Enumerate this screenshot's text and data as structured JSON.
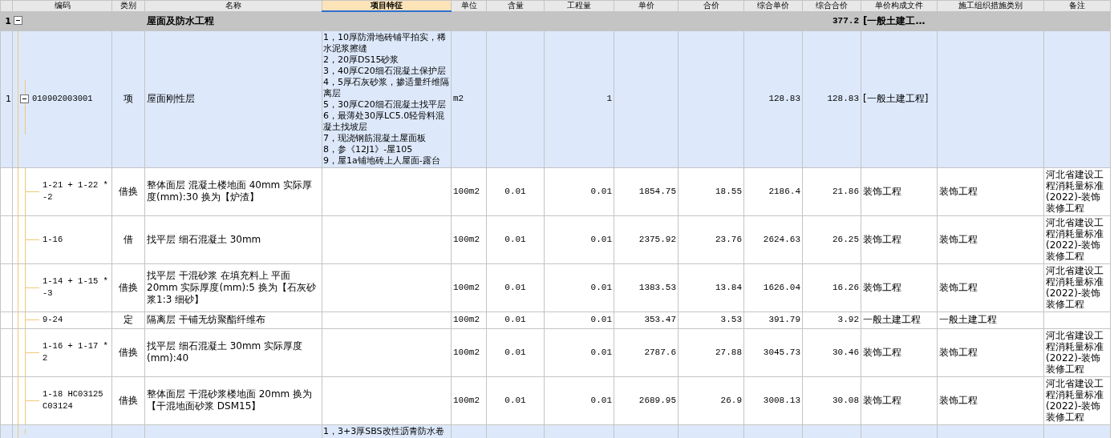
{
  "columns": [
    {
      "label": "编码",
      "selected": false
    },
    {
      "label": "类别",
      "selected": false
    },
    {
      "label": "名称",
      "selected": false
    },
    {
      "label": "项目特征",
      "selected": true
    },
    {
      "label": "单位",
      "selected": false
    },
    {
      "label": "含量",
      "selected": false
    },
    {
      "label": "工程量",
      "selected": false
    },
    {
      "label": "单价",
      "selected": false
    },
    {
      "label": "合价",
      "selected": false
    },
    {
      "label": "综合单价",
      "selected": false
    },
    {
      "label": "综合合价",
      "selected": false
    },
    {
      "label": "单价构成文件",
      "selected": false
    },
    {
      "label": "施工组织措施类别",
      "selected": false
    },
    {
      "label": "备注",
      "selected": false
    }
  ],
  "rows": [
    {
      "kind": "group",
      "number": "1",
      "expanded": true,
      "name": "屋面及防水工程",
      "comp_total": "377.2",
      "price_file": "[一般土建工…"
    },
    {
      "kind": "item",
      "number": "1",
      "expanded": true,
      "code": "010902003001",
      "type": "项",
      "name": "屋面刚性层",
      "features": "1，10厚防滑地砖铺平拍实，稀水泥浆擦缝\n2，20厚DS15砂浆\n3，40厚C20细石混凝土保护层\n4，5厚石灰砂浆，掺适量纤维隔离层\n5，30厚C20细石混凝土找平层\n6，最薄处30厚LC5.0轻骨料混凝土找坡层\n7，现浇钢筋混凝土屋面板\n8，参《12J1》-屋105\n9，屋1a铺地砖上人屋面-露台",
      "unit": "m2",
      "quantity": "1",
      "comp_unit_price": "128.83",
      "comp_total": "128.83",
      "price_file": "[一般土建工程]"
    },
    {
      "kind": "sub",
      "code": "1-21 + 1-22 * -2",
      "type": "借换",
      "name": "整体面层 混凝土楼地面 40mm  实际厚度(mm):30  换为【炉渣】",
      "unit": "100m2",
      "content": "0.01",
      "quantity": "0.01",
      "unit_price": "1854.75",
      "total_price": "18.55",
      "comp_unit_price": "2186.4",
      "comp_total": "21.86",
      "price_file": "装饰工程",
      "measure_category": "装饰工程",
      "remark": "河北省建设工程消耗量标准(2022)-装饰装修工程"
    },
    {
      "kind": "sub",
      "code": "1-16",
      "type": "借",
      "name": "找平层 细石混凝土 30mm",
      "unit": "100m2",
      "content": "0.01",
      "quantity": "0.01",
      "unit_price": "2375.92",
      "total_price": "23.76",
      "comp_unit_price": "2624.63",
      "comp_total": "26.25",
      "price_file": "装饰工程",
      "measure_category": "装饰工程",
      "remark": "河北省建设工程消耗量标准(2022)-装饰装修工程"
    },
    {
      "kind": "sub",
      "code": "1-14 + 1-15 * -3",
      "type": "借换",
      "name": "找平层 干混砂浆 在填充料上 平面 20mm  实际厚度(mm):5  换为【石灰砂浆1:3 细砂】",
      "unit": "100m2",
      "content": "0.01",
      "quantity": "0.01",
      "unit_price": "1383.53",
      "total_price": "13.84",
      "comp_unit_price": "1626.04",
      "comp_total": "16.26",
      "price_file": "装饰工程",
      "measure_category": "装饰工程",
      "remark": "河北省建设工程消耗量标准(2022)-装饰装修工程"
    },
    {
      "kind": "sub",
      "code": "9-24",
      "type": "定",
      "name": "隔离层 干铺无纺聚酯纤维布",
      "unit": "100m2",
      "content": "0.01",
      "quantity": "0.01",
      "unit_price": "353.47",
      "total_price": "3.53",
      "comp_unit_price": "391.79",
      "comp_total": "3.92",
      "price_file": "一般土建工程",
      "measure_category": "一般土建工程"
    },
    {
      "kind": "sub",
      "code": "1-16 + 1-17 * 2",
      "type": "借换",
      "name": "找平层 细石混凝土 30mm  实际厚度(mm):40",
      "unit": "100m2",
      "content": "0.01",
      "quantity": "0.01",
      "unit_price": "2787.6",
      "total_price": "27.88",
      "comp_unit_price": "3045.73",
      "comp_total": "30.46",
      "price_file": "装饰工程",
      "measure_category": "装饰工程",
      "remark": "河北省建设工程消耗量标准(2022)-装饰装修工程"
    },
    {
      "kind": "sub",
      "code": "1-18 HC03125 C03124",
      "type": "借换",
      "name": "整体面层 干混砂浆楼地面 20mm  换为【干混地面砂浆 DSM15】",
      "unit": "100m2",
      "content": "0.01",
      "quantity": "0.01",
      "unit_price": "2689.95",
      "total_price": "26.9",
      "comp_unit_price": "3008.13",
      "comp_total": "30.08",
      "price_file": "装饰工程",
      "measure_category": "装饰工程",
      "remark": "河北省建设工程消耗量标准(2022)-装饰装修工程"
    },
    {
      "kind": "item",
      "features": "1，3+3厚SBS改性沥青防水卷"
    }
  ]
}
